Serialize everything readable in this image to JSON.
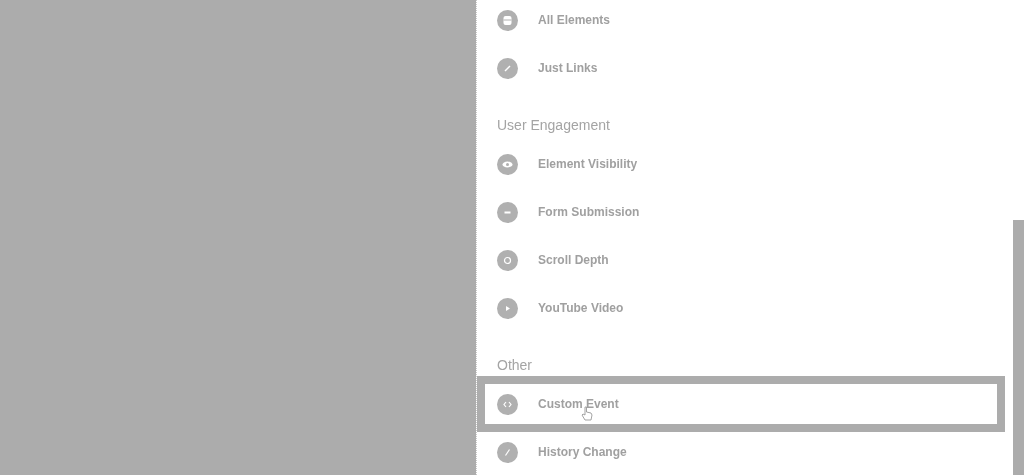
{
  "groups": [
    {
      "items": [
        {
          "label": "All Elements",
          "selected": false
        },
        {
          "label": "Just Links",
          "selected": false
        }
      ]
    },
    {
      "title": "User Engagement",
      "items": [
        {
          "label": "Element Visibility",
          "selected": false
        },
        {
          "label": "Form Submission",
          "selected": false
        },
        {
          "label": "Scroll Depth",
          "selected": false
        },
        {
          "label": "YouTube Video",
          "selected": false
        }
      ]
    },
    {
      "title": "Other",
      "items": [
        {
          "label": "Custom Event",
          "selected": true
        },
        {
          "label": "History Change",
          "selected": false
        }
      ]
    }
  ]
}
